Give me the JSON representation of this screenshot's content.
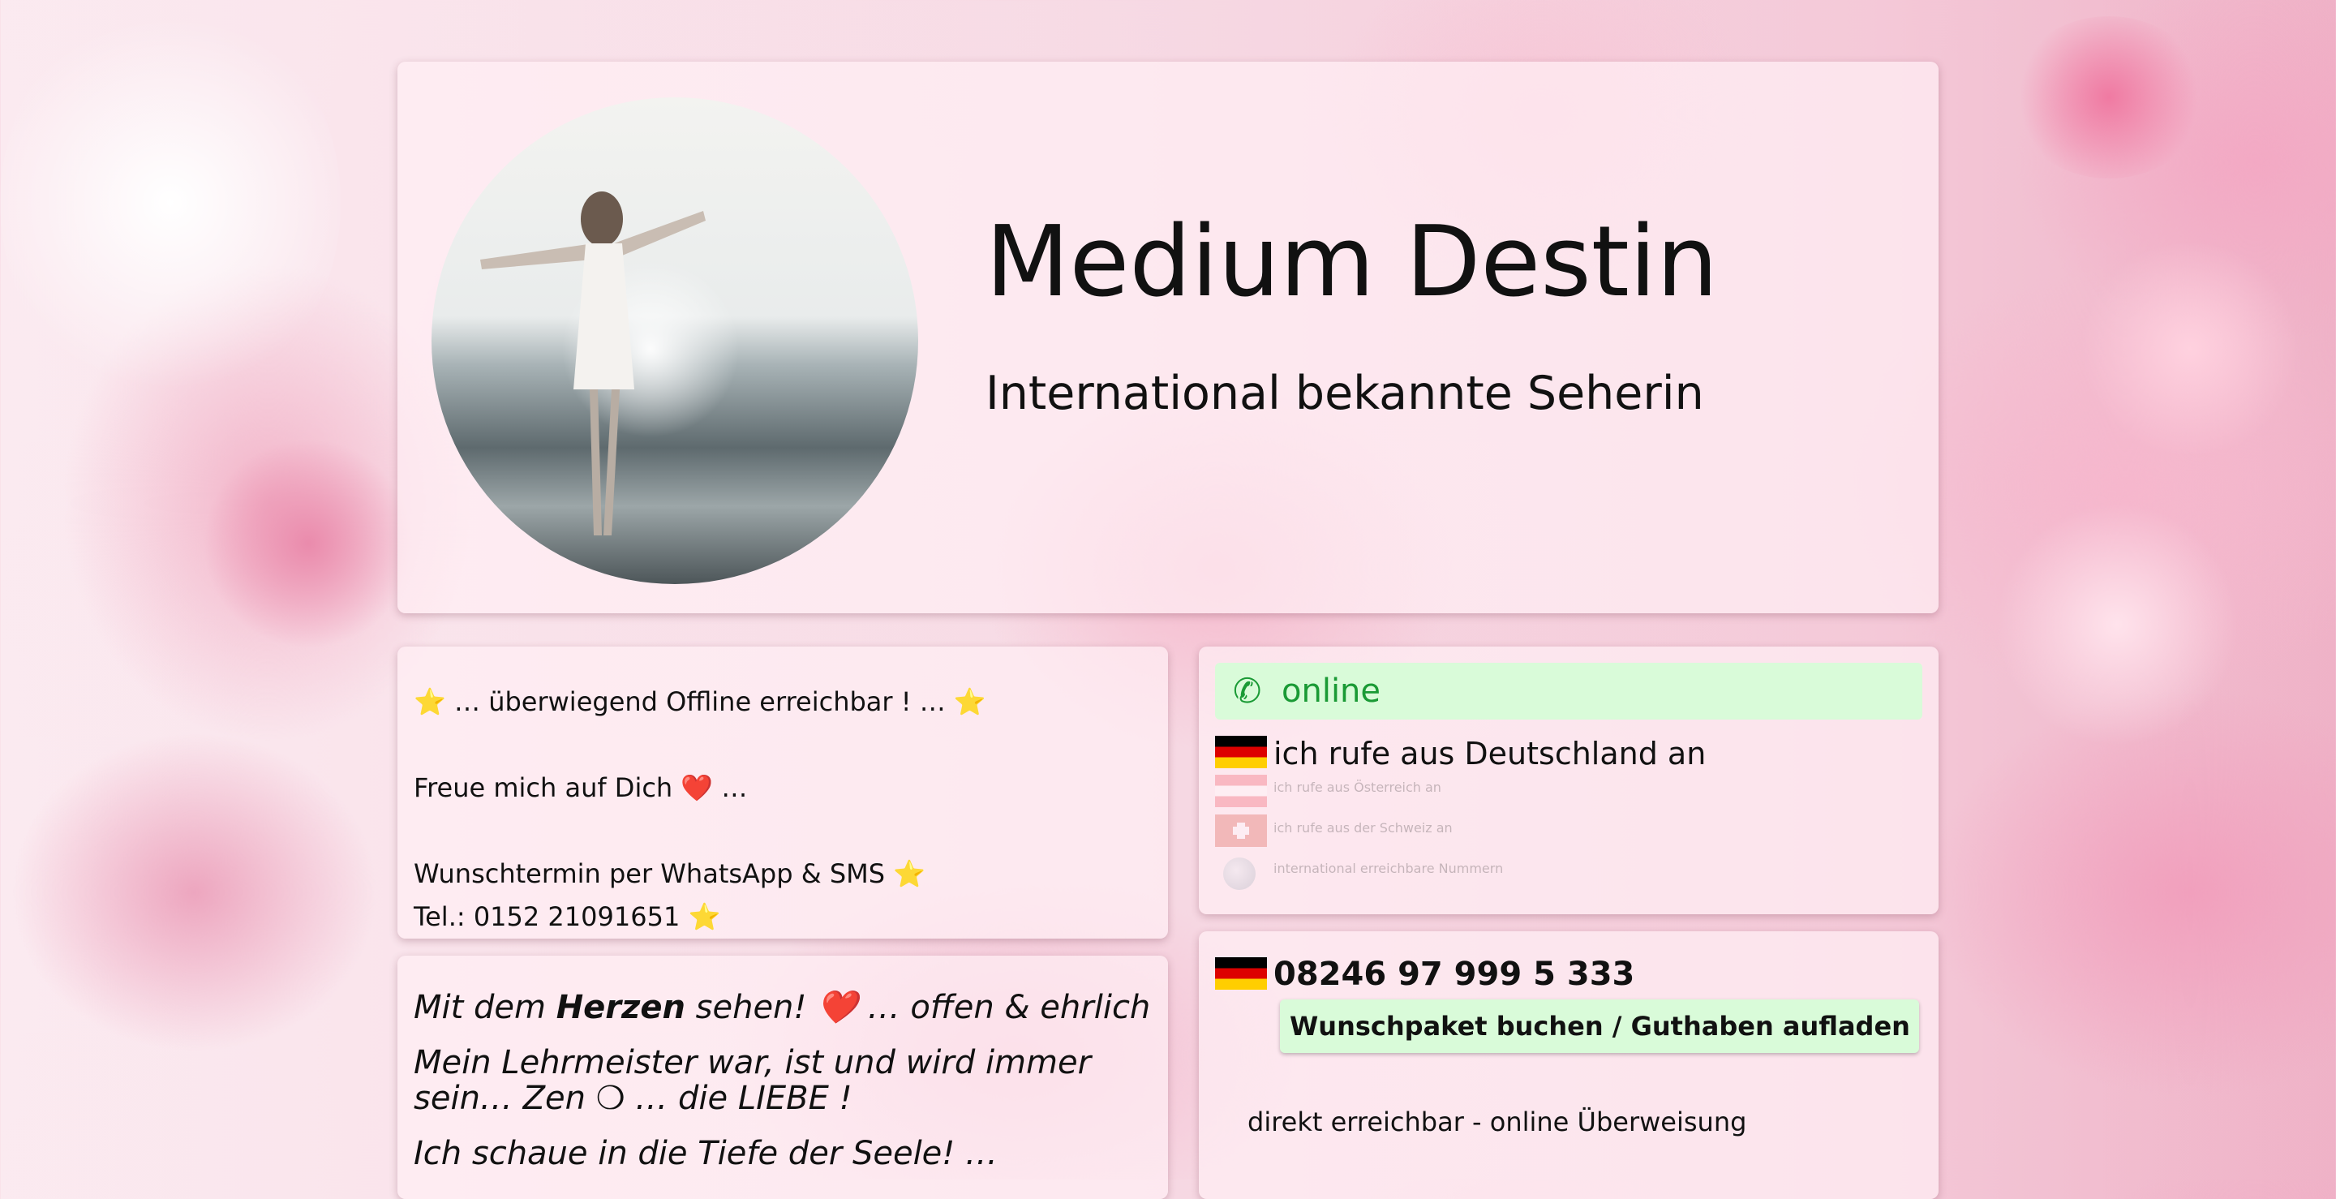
{
  "header": {
    "title": "Medium Destin",
    "subtitle": "International bekannte Seherin"
  },
  "status": {
    "line1": "⭐ … überwiegend Offline erreichbar ! … ⭐",
    "line2": "Freue mich auf Dich ❤️ …",
    "line3": "Wunschtermin per WhatsApp & SMS ⭐",
    "line4": "Tel.: 0152 21091651 ⭐"
  },
  "about": {
    "line1_pre": "Mit dem ",
    "line1_bold": "Herzen",
    "line1_post": " sehen! ❤️ … offen & ehrlich",
    "line2": "Mein Lehrmeister war, ist und wird immer sein… Zen ❍ … die LIEBE !",
    "line3": "Ich schaue in die Tiefe der Seele! …"
  },
  "phone_widget": {
    "online_label": "online",
    "countries": [
      "ich rufe aus Deutschland an",
      "ich rufe aus Österreich an",
      "ich rufe aus der Schweiz an",
      "international erreichbare Nummern"
    ]
  },
  "contact": {
    "number": "08246 97 999 5 333",
    "book_button": "Wunschpaket buchen / Guthaben aufladen",
    "note": "direkt erreichbar - online Überweisung"
  },
  "colors": {
    "online_green": "#1a9a35",
    "pill_bg": "#d9fbd9",
    "card_bg": "#ffeef4"
  }
}
